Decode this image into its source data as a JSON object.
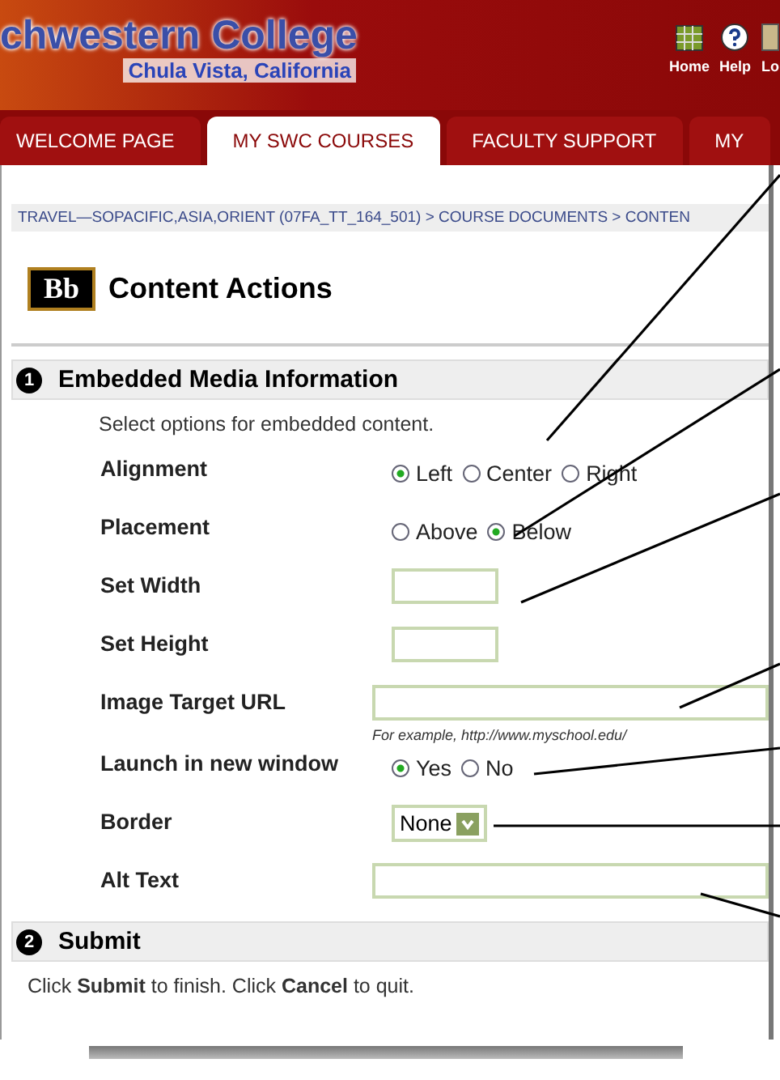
{
  "header": {
    "logo_title": "chwestern College",
    "logo_subtitle": "Chula Vista, California",
    "links": [
      {
        "label": "Home",
        "kind": "grid"
      },
      {
        "label": "Help",
        "kind": "help"
      },
      {
        "label": "Lo",
        "kind": "map"
      }
    ]
  },
  "tabs": [
    {
      "label": "WELCOME PAGE",
      "selected": false
    },
    {
      "label": "MY SWC COURSES",
      "selected": true
    },
    {
      "label": "FACULTY SUPPORT",
      "selected": false
    },
    {
      "label": "MY",
      "selected": false
    }
  ],
  "breadcrumb": "TRAVEL—SOPACIFIC,ASIA,ORIENT (07FA_TT_164_501) > COURSE DOCUMENTS > CONTEN",
  "logo_badge": "Bb",
  "page_title": "Content Actions",
  "sections": [
    {
      "number": "1",
      "title": "Embedded Media Information",
      "intro": "Select options for embedded content.",
      "fields": [
        {
          "label": "Alignment",
          "kind": "radio",
          "options": [
            {
              "label": "Left",
              "selected": true
            },
            {
              "label": "Center",
              "selected": false
            },
            {
              "label": "Right",
              "selected": false
            }
          ]
        },
        {
          "label": "Placement",
          "kind": "radio",
          "options": [
            {
              "label": "Above",
              "selected": false
            },
            {
              "label": "Below",
              "selected": true
            }
          ]
        },
        {
          "label": "Set Width",
          "kind": "small_text"
        },
        {
          "label": "Set Height",
          "kind": "small_text"
        },
        {
          "label": "Image Target URL",
          "kind": "wide_text",
          "hint": "For example, http://www.myschool.edu/"
        },
        {
          "label": "Launch in new window",
          "kind": "radio",
          "options": [
            {
              "label": "Yes",
              "selected": true
            },
            {
              "label": "No",
              "selected": false
            }
          ]
        },
        {
          "label": "Border",
          "kind": "select",
          "value": "None"
        },
        {
          "label": "Alt Text",
          "kind": "wide_text"
        }
      ]
    },
    {
      "number": "2",
      "title": "Submit",
      "intro": "Click **Submit** to finish. Click **Cancel** to quit."
    }
  ]
}
